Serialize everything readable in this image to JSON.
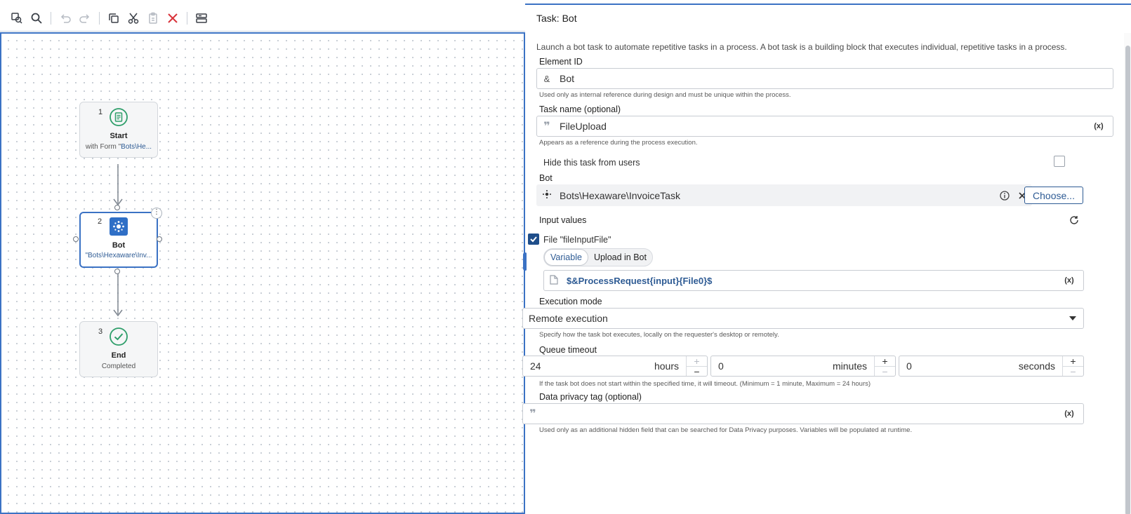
{
  "toolbar": {
    "buttons": [
      "zoom-fit",
      "search",
      "undo",
      "redo",
      "copy",
      "cut",
      "paste",
      "delete",
      "layout"
    ]
  },
  "flow": {
    "nodes": [
      {
        "num": "1",
        "title": "Start",
        "sub_prefix": "with Form \"",
        "sub_link": "Bots\\He..."
      },
      {
        "num": "2",
        "title": "Bot",
        "sub_prefix": "",
        "sub_link": "\"Bots\\Hexaware\\Inv..."
      },
      {
        "num": "3",
        "title": "End",
        "sub_prefix": "",
        "sub_link": "Completed"
      }
    ]
  },
  "panel": {
    "title": "Task: Bot",
    "description": "Launch a bot task to automate repetitive tasks in a process. A bot task is a building block that executes individual, repetitive tasks in a process.",
    "element_id": {
      "label": "Element ID",
      "prefix": "&",
      "value": "Bot",
      "helper": "Used only as internal reference during design and must be unique within the process."
    },
    "task_name": {
      "label": "Task name (optional)",
      "value": "FileUpload",
      "var_btn": "(x)",
      "helper": "Appears as a reference during the process execution."
    },
    "hide_task": {
      "label": "Hide this task from users",
      "checked": false
    },
    "bot": {
      "label": "Bot",
      "value": "Bots\\Hexaware\\InvoiceTask",
      "choose_label": "Choose..."
    },
    "input_values": {
      "label": "Input values",
      "file_label": "File \"fileInputFile\"",
      "file_checked": true,
      "tabs": [
        "Variable",
        "Upload in Bot"
      ],
      "active_tab": "Variable",
      "value": "$&ProcessRequest{input}{File0}$",
      "var_btn": "(x)"
    },
    "execution_mode": {
      "label": "Execution mode",
      "value": "Remote execution",
      "helper": "Specify how the task bot executes, locally on the requester's desktop or remotely."
    },
    "queue_timeout": {
      "label": "Queue timeout",
      "hours_value": "24",
      "hours_unit": "hours",
      "minutes_value": "0",
      "minutes_unit": "minutes",
      "seconds_value": "0",
      "seconds_unit": "seconds",
      "plus": "+",
      "minus": "−",
      "helper": "If the task bot does not start within the specified time, it will timeout. (Minimum = 1 minute, Maximum = 24 hours)"
    },
    "privacy_tag": {
      "label": "Data privacy tag (optional)",
      "value": "",
      "var_btn": "(x)",
      "helper": "Used only as an additional hidden field that can be searched for Data Privacy purposes. Variables will be populated at runtime."
    }
  },
  "colors": {
    "accent": "#3b72c4",
    "link": "#2e5b94",
    "start_icon": "#2e9e6a",
    "bot_icon_bg": "#2f6fc6",
    "delete": "#d9343b"
  }
}
